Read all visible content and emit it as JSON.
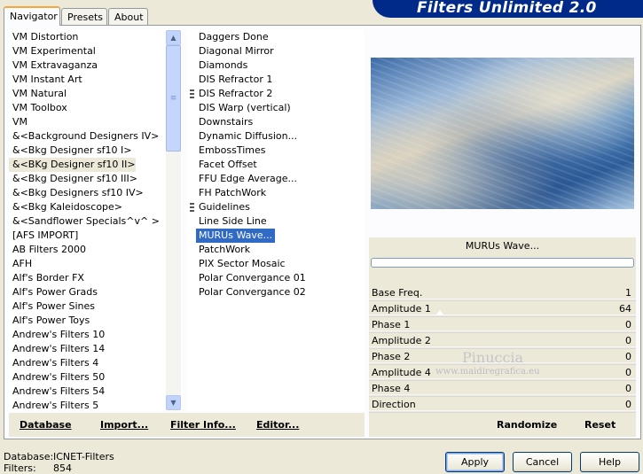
{
  "tabs": [
    "Navigator",
    "Presets",
    "About"
  ],
  "app_title": "Filters Unlimited 2.0",
  "categories": [
    "VM Distortion",
    "VM Experimental",
    "VM Extravaganza",
    "VM Instant Art",
    "VM Natural",
    "VM Toolbox",
    "VM",
    "&<Background Designers IV>",
    "&<Bkg Designer sf10 I>",
    "&<BKg Designer sf10 II>",
    "&<Bkg Designer sf10 III>",
    "&<Bkg Designers sf10 IV>",
    "&<Bkg Kaleidoscope>",
    "&<Sandflower Specials^v^ >",
    "[AFS IMPORT]",
    "AB Filters 2000",
    "AFH",
    "Alf's Border FX",
    "Alf's Power Grads",
    "Alf's Power Sines",
    "Alf's Power Toys",
    "Andrew's Filters 10",
    "Andrew's Filters 14",
    "Andrew's Filters 4",
    "Andrew's Filters 50",
    "Andrew's Filters 54",
    "Andrew's Filters 5"
  ],
  "selected_category_index": 9,
  "filters": [
    "Daggers Done",
    "Diagonal Mirror",
    "Diamonds",
    "DIS Refractor 1",
    "DIS Refractor 2",
    "DIS Warp (vertical)",
    "Downstairs",
    "Dynamic Diffusion...",
    "EmbossTimes",
    "Facet Offset",
    "FFU Edge Average...",
    "FH PatchWork",
    "Guidelines",
    "Line Side Line",
    "MURUs Wave...",
    "PatchWork",
    "PIX Sector Mosaic",
    "Polar Convergance 01",
    "Polar Convergance 02"
  ],
  "selected_filter_index": 14,
  "current_filter_name": "MURUs Wave...",
  "params": [
    {
      "label": "Base Freq.",
      "value": "1"
    },
    {
      "label": "Amplitude 1",
      "value": "64"
    },
    {
      "label": "Phase 1",
      "value": "0"
    },
    {
      "label": "Amplitude 2",
      "value": "0"
    },
    {
      "label": "Phase 2",
      "value": "0"
    },
    {
      "label": "Amplitude 4",
      "value": "0"
    },
    {
      "label": "Phase 4",
      "value": "0"
    },
    {
      "label": "Direction",
      "value": "0"
    }
  ],
  "watermark": {
    "name": "Pinuccia",
    "url": "www.maidiregrafica.eu"
  },
  "toolbar": {
    "database": "Database",
    "import": "Import...",
    "filter_info": "Filter Info...",
    "editor": "Editor...",
    "randomize": "Randomize",
    "reset": "Reset"
  },
  "status": {
    "database_label": "Database:",
    "database_value": "ICNET-Filters",
    "filters_label": "Filters:",
    "filters_value": "854"
  },
  "buttons": {
    "apply": "Apply",
    "cancel": "Cancel",
    "help": "Help"
  }
}
